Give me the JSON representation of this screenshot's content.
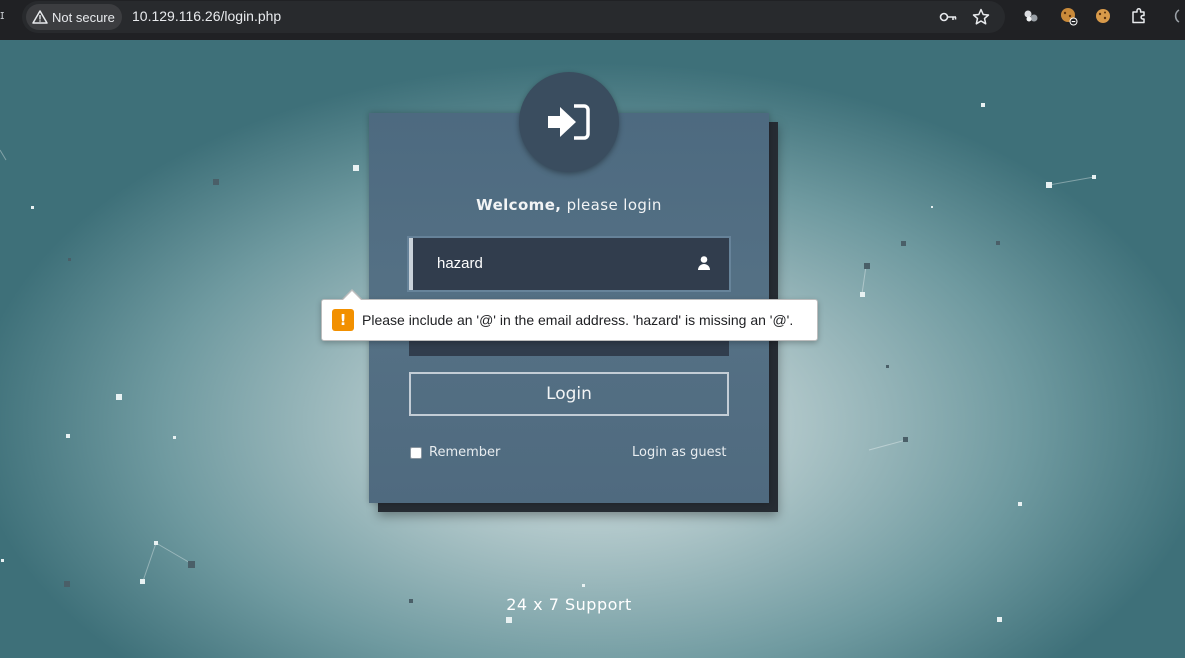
{
  "browser": {
    "security_label": "Not secure",
    "url": "10.129.116.26/login.php",
    "icons": [
      "warning-triangle-icon",
      "key-icon",
      "star-icon",
      "extension-puzzle-icon"
    ]
  },
  "login": {
    "welcome_bold": "Welcome,",
    "welcome_rest": "please login",
    "email_value": "hazard",
    "login_button": "Login",
    "remember_label": "Remember",
    "guest_link": "Login as guest"
  },
  "validation": {
    "message": "Please include an '@' in the email address. 'hazard' is missing an '@'.",
    "icon": "!"
  },
  "footer": {
    "support": "24 x 7 Support"
  },
  "colors": {
    "accent_warning": "#f29000",
    "card": "#506c81",
    "field": "#313d4d"
  }
}
